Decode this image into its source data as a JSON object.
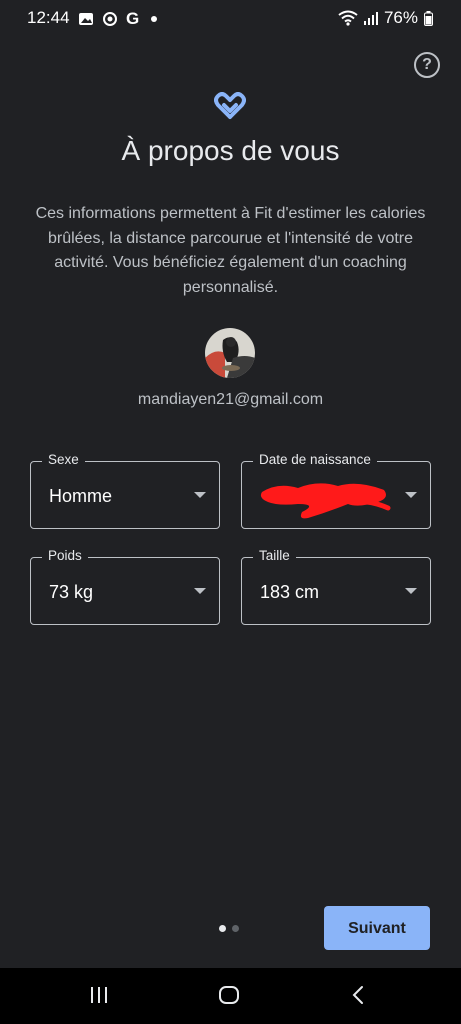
{
  "status_bar": {
    "time": "12:44",
    "left_icons": [
      "gallery-icon",
      "focus-mode-icon",
      "google-icon",
      "notification-dot-icon"
    ],
    "google_letter": "G",
    "battery": "76%",
    "right_icons": [
      "wifi-icon",
      "signal-icon",
      "battery-icon"
    ]
  },
  "page": {
    "title": "À propos de vous",
    "description": "Ces informations permettent à Fit d'estimer les calories brûlées, la distance parcourue et l'intensité de votre activité. Vous bénéficiez également d'un coaching personnalisé.",
    "email": "mandiayen21@gmail.com",
    "help_icon": "help-icon",
    "logo_icon": "google-fit-heart-icon"
  },
  "fields": {
    "sexe": {
      "label": "Sexe",
      "value": "Homme"
    },
    "date": {
      "label": "Date de naissance",
      "value": ""
    },
    "poids": {
      "label": "Poids",
      "value": "73 kg"
    },
    "taille": {
      "label": "Taille",
      "value": "183 cm"
    }
  },
  "pager": {
    "current_page": 1,
    "total_pages": 2
  },
  "actions": {
    "next_label": "Suivant"
  },
  "colors": {
    "background": "#202124",
    "accent": "#8ab4f8",
    "text_primary": "#e8eaed",
    "text_secondary": "#bdc1c6",
    "redaction": "#ff1a1a"
  }
}
